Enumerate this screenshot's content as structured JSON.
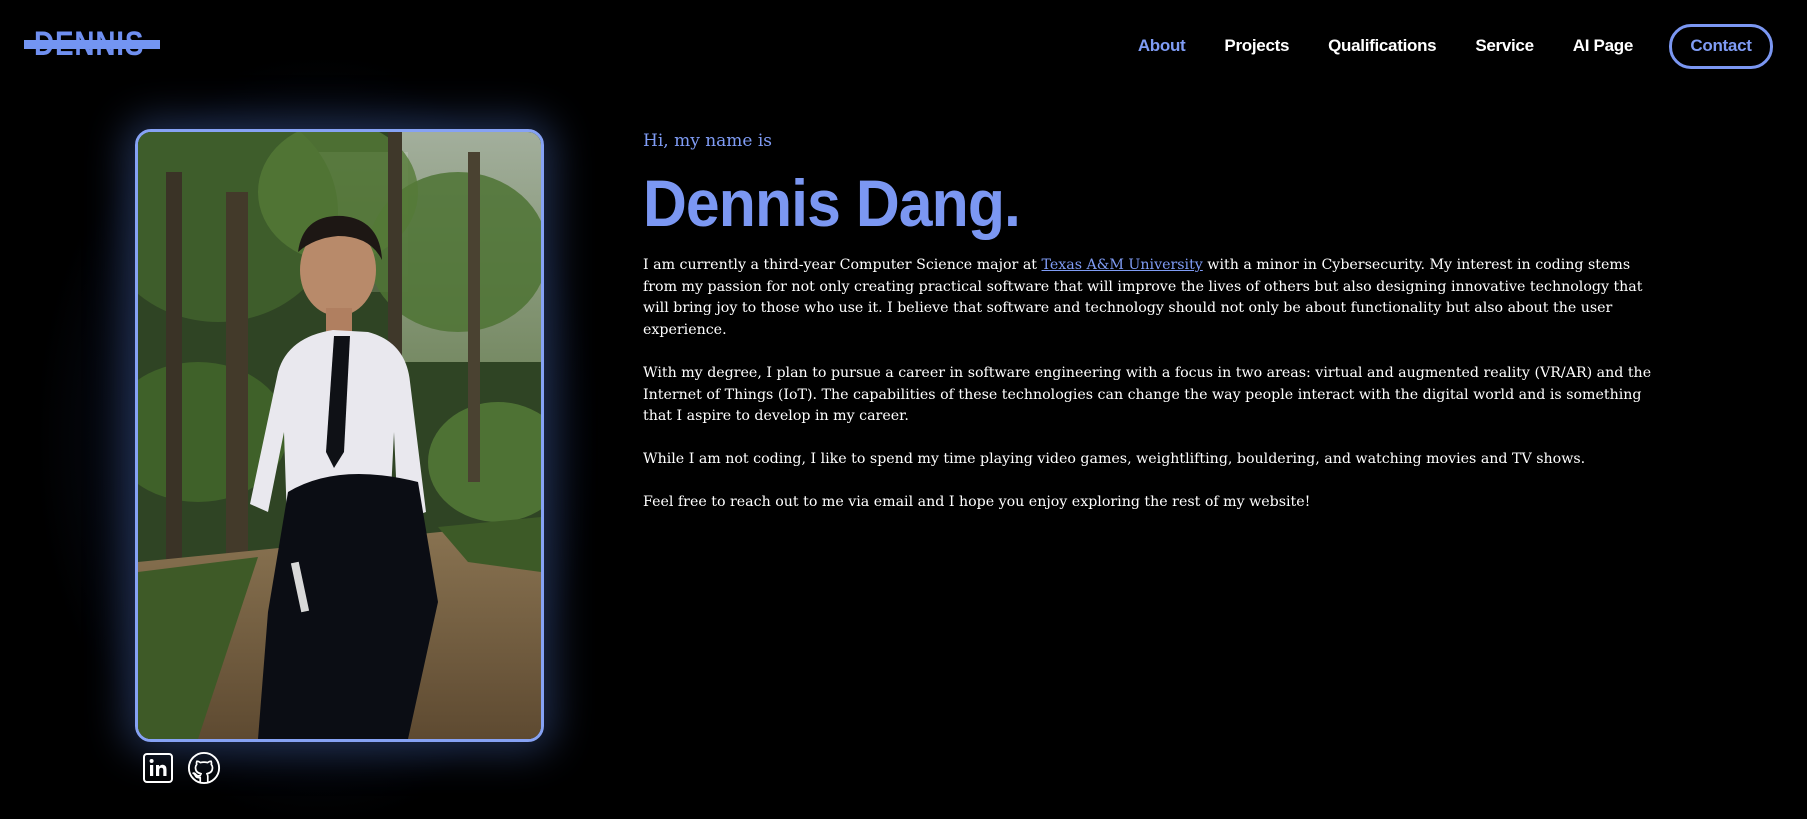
{
  "header": {
    "logo_text": "DENNIS",
    "nav": [
      {
        "label": "About",
        "active": true
      },
      {
        "label": "Projects",
        "active": false
      },
      {
        "label": "Qualifications",
        "active": false
      },
      {
        "label": "Service",
        "active": false
      },
      {
        "label": "AI Page",
        "active": false
      }
    ],
    "contact_label": "Contact"
  },
  "profile": {
    "photo_alt": "linkedin-icon",
    "social": [
      {
        "icon": "linkedin-icon"
      },
      {
        "icon": "github-icon"
      }
    ]
  },
  "intro": {
    "greeting": "Hi, my name is",
    "name": "Dennis Dang.",
    "p1_before": "I am currently a third-year Computer Science major at ",
    "p1_link": "Texas A&M University",
    "p1_after": " with a minor in Cybersecurity. My interest in coding stems from my passion for not only creating practical software that will improve the lives of others but also designing innovative technology that will bring joy to those who use it. I believe that software and technology should not only be about functionality but also about the user experience.",
    "p2": "With my degree, I plan to pursue a career in software engineering with a focus in two areas: virtual and augmented reality (VR/AR) and the Internet of Things (IoT). The capabilities of these technologies can change the way people interact with the digital world and is something that I aspire to develop in my career.",
    "p3": "While I am not coding, I like to spend my time playing video games, weightlifting, bouldering, and watching movies and TV shows.",
    "p4": "Feel free to reach out to me via email and I hope you enjoy exploring the rest of my website!"
  },
  "colors": {
    "accent": "#7b97f2",
    "background": "#000000",
    "text": "#ffffff"
  }
}
